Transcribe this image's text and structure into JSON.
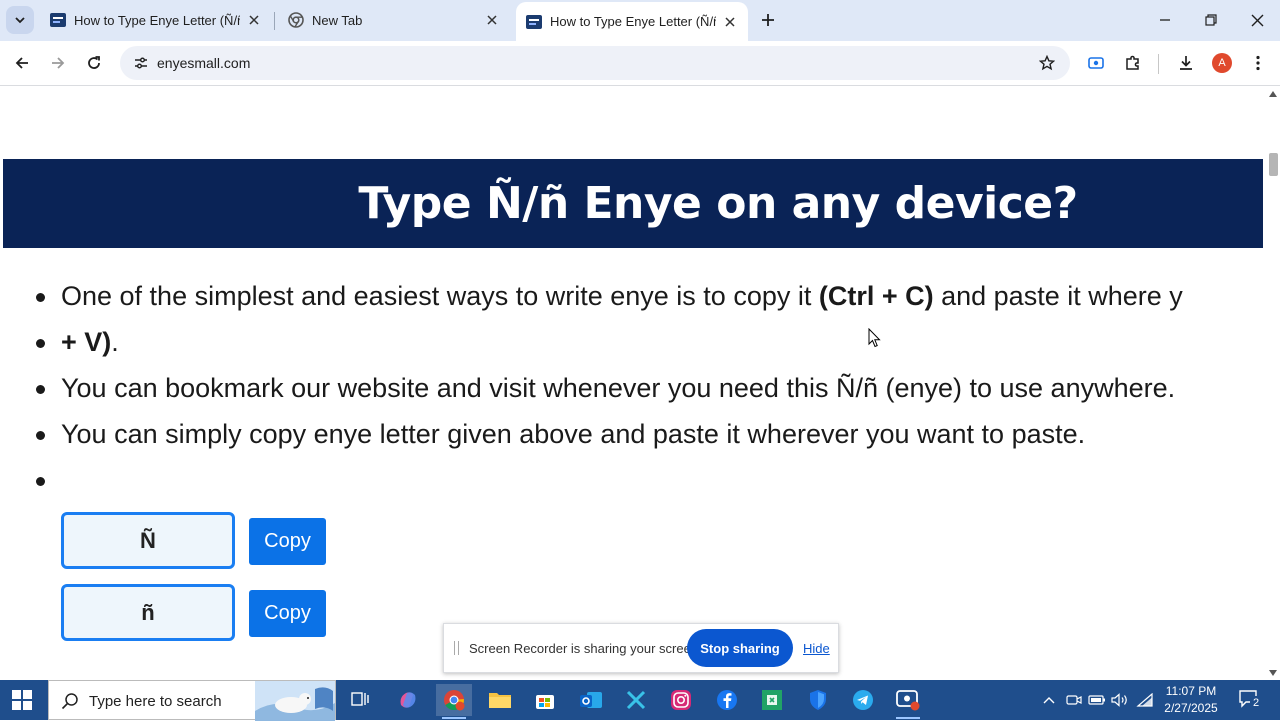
{
  "browser": {
    "tabs": [
      {
        "title": "How to Type Enye Letter (Ñ/ñ) I",
        "active": false
      },
      {
        "title": "New Tab",
        "active": false
      },
      {
        "title": "How to Type Enye Letter (Ñ/ñ) I",
        "active": true
      }
    ],
    "url": "enyesmall.com",
    "profile_initial": "A"
  },
  "page": {
    "banner_title": "Type Ñ/ñ Enye on any device?",
    "bullets": {
      "b1_part1": "One of the simplest and easiest ways to write enye is to copy it ",
      "b1_bold1": "(Ctrl + C)",
      "b1_part2": " and paste it where y",
      "b1_bold2": "+ V)",
      "b1_end": ".",
      "b2": "You can bookmark our website and visit whenever you need this Ñ/ñ (enye) to use anywhere.",
      "b3": "You can simply copy enye letter given above and paste it wherever you want to paste.",
      "b4": ""
    },
    "letters": [
      {
        "char": "Ñ",
        "button": "Copy"
      },
      {
        "char": "ñ",
        "button": "Copy"
      }
    ]
  },
  "sharebar": {
    "message": "Screen Recorder is sharing your screen.",
    "stop_label": "Stop sharing",
    "hide_label": "Hide"
  },
  "taskbar": {
    "search_placeholder": "Type here to search",
    "time": "11:07 PM",
    "date": "2/27/2025",
    "notification_count": "2"
  },
  "colors": {
    "banner": "#0a2356",
    "accent": "#0b72e7",
    "taskbar": "#1f4e8c"
  }
}
